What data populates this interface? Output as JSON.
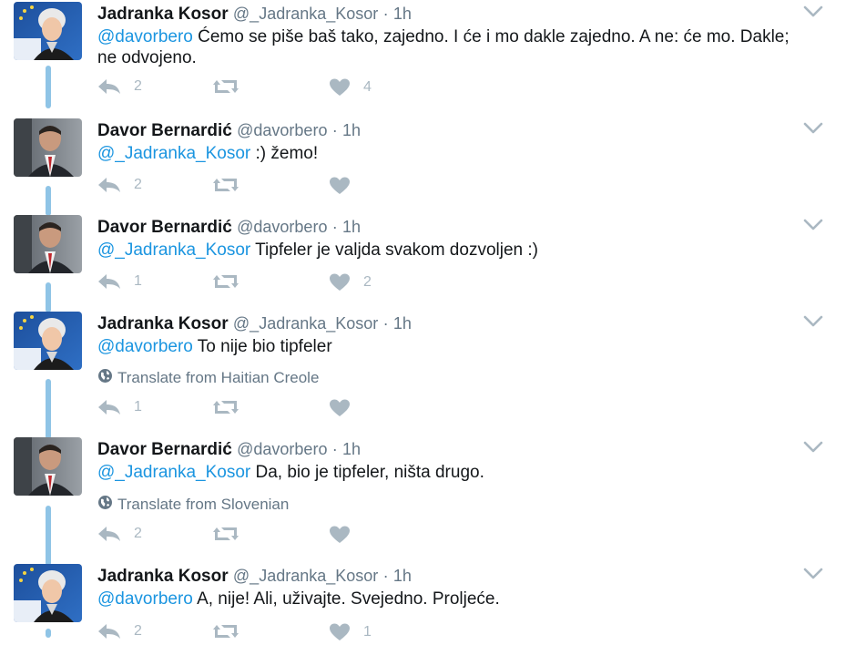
{
  "colors": {
    "mention": "#1b95e0",
    "muted": "#657786",
    "icon": "#aab8c2",
    "thread": "#8fc4e6"
  },
  "icons": {
    "reply": "reply-icon",
    "retweet": "retweet-icon",
    "like": "heart-icon",
    "caret": "chevron-down-icon",
    "globe": "globe-icon"
  },
  "tweets": [
    {
      "name": "Jadranka Kosor",
      "handle": "@_Jadranka_Kosor",
      "sep": "·",
      "time": "1h",
      "mention": "@davorbero",
      "text": " Ćemo se piše baš tako, zajedno. I će i mo dakle zajedno. A ne: će mo. Dakle; ne odvojeno.",
      "translate": "",
      "replies": "2",
      "retweets": "",
      "likes": "4"
    },
    {
      "name": "Davor Bernardić",
      "handle": "@davorbero",
      "sep": "·",
      "time": "1h",
      "mention": "@_Jadranka_Kosor",
      "text": " :) žemo!",
      "translate": "",
      "replies": "2",
      "retweets": "",
      "likes": ""
    },
    {
      "name": "Davor Bernardić",
      "handle": "@davorbero",
      "sep": "·",
      "time": "1h",
      "mention": "@_Jadranka_Kosor",
      "text": " Tipfeler je valjda svakom dozvoljen :)",
      "translate": "",
      "replies": "1",
      "retweets": "",
      "likes": "2"
    },
    {
      "name": "Jadranka Kosor",
      "handle": "@_Jadranka_Kosor",
      "sep": "·",
      "time": "1h",
      "mention": "@davorbero",
      "text": " To nije bio tipfeler",
      "translate": "Translate from Haitian Creole",
      "replies": "1",
      "retweets": "",
      "likes": ""
    },
    {
      "name": "Davor Bernardić",
      "handle": "@davorbero",
      "sep": "·",
      "time": "1h",
      "mention": "@_Jadranka_Kosor",
      "text": " Da, bio je tipfeler, ništa drugo.",
      "translate": "Translate from Slovenian",
      "replies": "2",
      "retweets": "",
      "likes": ""
    },
    {
      "name": "Jadranka Kosor",
      "handle": "@_Jadranka_Kosor",
      "sep": "·",
      "time": "1h",
      "mention": "@davorbero",
      "text": " A, nije! Ali, uživajte. Svejedno. Proljeće.",
      "translate": "",
      "replies": "2",
      "retweets": "",
      "likes": "1"
    }
  ]
}
